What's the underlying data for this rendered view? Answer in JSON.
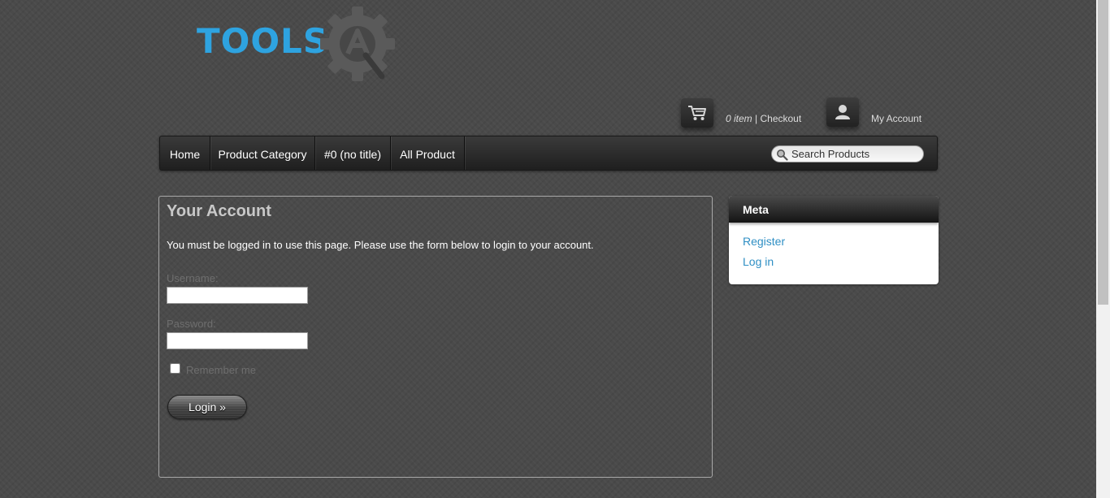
{
  "logo": {
    "text": "TOOLS",
    "gear_letter": "A",
    "text_color": "#2ea3e0"
  },
  "header": {
    "cart_count": "0 item",
    "cart_separator": " | ",
    "checkout_label": "Checkout",
    "account_label": "My Account",
    "cart_icon": "shopping-cart-icon",
    "account_icon": "user-icon"
  },
  "nav": {
    "items": [
      {
        "label": "Home"
      },
      {
        "label": "Product Category"
      },
      {
        "label": "#0 (no title)"
      },
      {
        "label": "All Product"
      }
    ]
  },
  "search": {
    "placeholder": "Search Products",
    "icon": "search-icon"
  },
  "main": {
    "title": "Your Account",
    "notice": "You must be logged in to use this page. Please use the form below to login to your account.",
    "username_label": "Username:",
    "username_value": "",
    "password_label": "Password:",
    "password_value": "",
    "remember_label": "Remember me",
    "login_button": "Login »"
  },
  "sidebar": {
    "widget_title": "Meta",
    "links": [
      {
        "label": "Register"
      },
      {
        "label": "Log in"
      }
    ]
  },
  "colors": {
    "background": "#4a4a4a",
    "link": "#2f8fc4",
    "title": "#c8c8c8"
  }
}
